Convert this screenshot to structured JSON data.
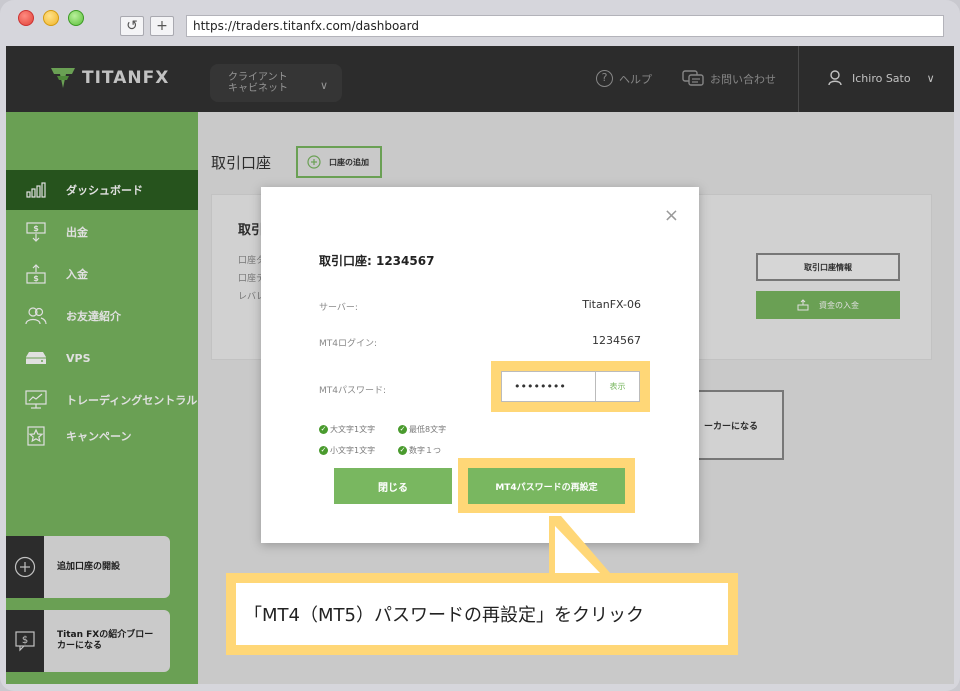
{
  "browser": {
    "url": "https://traders.titanfx.com/dashboard",
    "refresh_icon": "refresh-icon",
    "new_tab_icon": "plus-icon"
  },
  "header": {
    "logo_text": "TITANFX",
    "client_menu": {
      "line1": "クライアント",
      "line2": "キャビネット"
    },
    "help_label": "ヘルプ",
    "contact_label": "お問い合わせ",
    "user_name": "Ichiro Sato"
  },
  "sidebar": {
    "items": [
      {
        "label": "ダッシュボード",
        "icon": "bar-chart-icon",
        "active": true
      },
      {
        "label": "出金",
        "icon": "withdraw-icon"
      },
      {
        "label": "入金",
        "icon": "deposit-icon"
      },
      {
        "label": "お友達紹介",
        "icon": "users-icon"
      },
      {
        "label": "VPS",
        "icon": "server-icon"
      },
      {
        "label": "トレーディングセントラル",
        "icon": "monitor-chart-icon"
      },
      {
        "label": "キャンペーン",
        "icon": "star-badge-icon"
      }
    ],
    "cards": [
      {
        "label": "追加口座の開設",
        "icon": "plus-circle-icon"
      },
      {
        "label_line1": "Titan FXの紹介ブロー",
        "label_line2": "カーになる",
        "icon": "dollar-screen-icon"
      }
    ]
  },
  "main": {
    "title": "取引口座",
    "add_account_label": "口座の追加",
    "card": {
      "heading": "取引口",
      "rows": [
        "口座タ",
        "口座テ",
        "レバレ"
      ],
      "info_button": "取引口座情報",
      "deposit_button": "資金の入金"
    },
    "broker_button": "ーカーになる"
  },
  "modal": {
    "title": "取引口座: 1234567",
    "server_label": "サーバー:",
    "server_value": "TitanFX-06",
    "login_label": "MT4ログイン:",
    "login_value": "1234567",
    "password_label": "MT4パスワード:",
    "password_value": "••••••••",
    "show_label": "表示",
    "rules": [
      "大文字1文字",
      "最低8文字",
      "小文字1文字",
      "数字１つ"
    ],
    "close_button": "閉じる",
    "reset_button": "MT4パスワードの再設定"
  },
  "callout": {
    "text": "「MT4（MT5）パスワードの再設定」をクリック"
  },
  "colors": {
    "brand_green": "#79b760",
    "dark_green": "#2c5f21",
    "highlight": "#ffd777",
    "topbar": "#333333"
  }
}
